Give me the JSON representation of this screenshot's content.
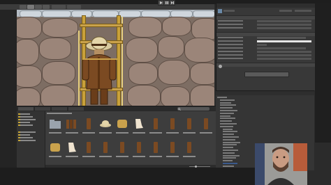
{
  "editor": {
    "title": "",
    "menu_items": [
      "",
      "",
      "",
      "",
      "",
      "",
      ""
    ]
  },
  "toolbar": {
    "tools": [
      "hand-tool",
      "move-tool",
      "rotate-tool",
      "scale-tool",
      "rect-tool"
    ],
    "pivot_label": "",
    "global_label": "",
    "play_controls": [
      "play",
      "pause",
      "step"
    ]
  },
  "scene": {
    "tab_label": "",
    "character": "explorer-on-ladder"
  },
  "inspector": {
    "tab_label": "",
    "object_name": "",
    "add_component_label": ""
  },
  "hierarchy": {
    "tab_label": "",
    "rows": [
      "",
      "",
      "",
      "",
      "",
      "",
      "",
      "",
      "",
      "",
      "",
      "",
      "",
      "",
      "",
      "",
      "",
      "",
      "",
      "",
      "",
      "",
      "",
      "",
      "",
      "",
      ""
    ],
    "selected_index": 25
  },
  "project": {
    "tabs": [
      "",
      "",
      "",
      ""
    ],
    "tree": [
      "",
      "",
      "",
      "",
      "",
      "",
      "",
      "",
      ""
    ],
    "breadcrumb": "",
    "assets": [
      {
        "icon": "folder-icon",
        "label": ""
      },
      {
        "icon": "sprite-sheet-icon",
        "label": ""
      },
      {
        "icon": "plank-icon",
        "label": ""
      },
      {
        "icon": "hat-icon",
        "label": ""
      },
      {
        "icon": "stone-icon",
        "label": ""
      },
      {
        "icon": "boot-icon",
        "label": ""
      },
      {
        "icon": "plank-icon",
        "label": ""
      },
      {
        "icon": "plank-icon",
        "label": ""
      },
      {
        "icon": "plank-icon",
        "label": ""
      },
      {
        "icon": "plank-icon",
        "label": ""
      },
      {
        "icon": "stone-icon",
        "label": ""
      },
      {
        "icon": "boot-icon",
        "label": ""
      },
      {
        "icon": "plank-icon",
        "label": ""
      },
      {
        "icon": "plank-icon",
        "label": ""
      },
      {
        "icon": "plank-icon",
        "label": ""
      },
      {
        "icon": "plank-icon",
        "label": ""
      },
      {
        "icon": "plank-icon",
        "label": ""
      },
      {
        "icon": "plank-icon",
        "label": ""
      },
      {
        "icon": "plank-icon",
        "label": ""
      }
    ]
  },
  "colors": {
    "editor_bg": "#2b2b2b",
    "panel_bg": "#383838",
    "selection": "#3b5a8c",
    "stone": "#9b8579",
    "stone_dark": "#5f4f46",
    "ladder": "#c9a13a",
    "coat": "#7b4a22",
    "hat": "#d6c59a"
  }
}
